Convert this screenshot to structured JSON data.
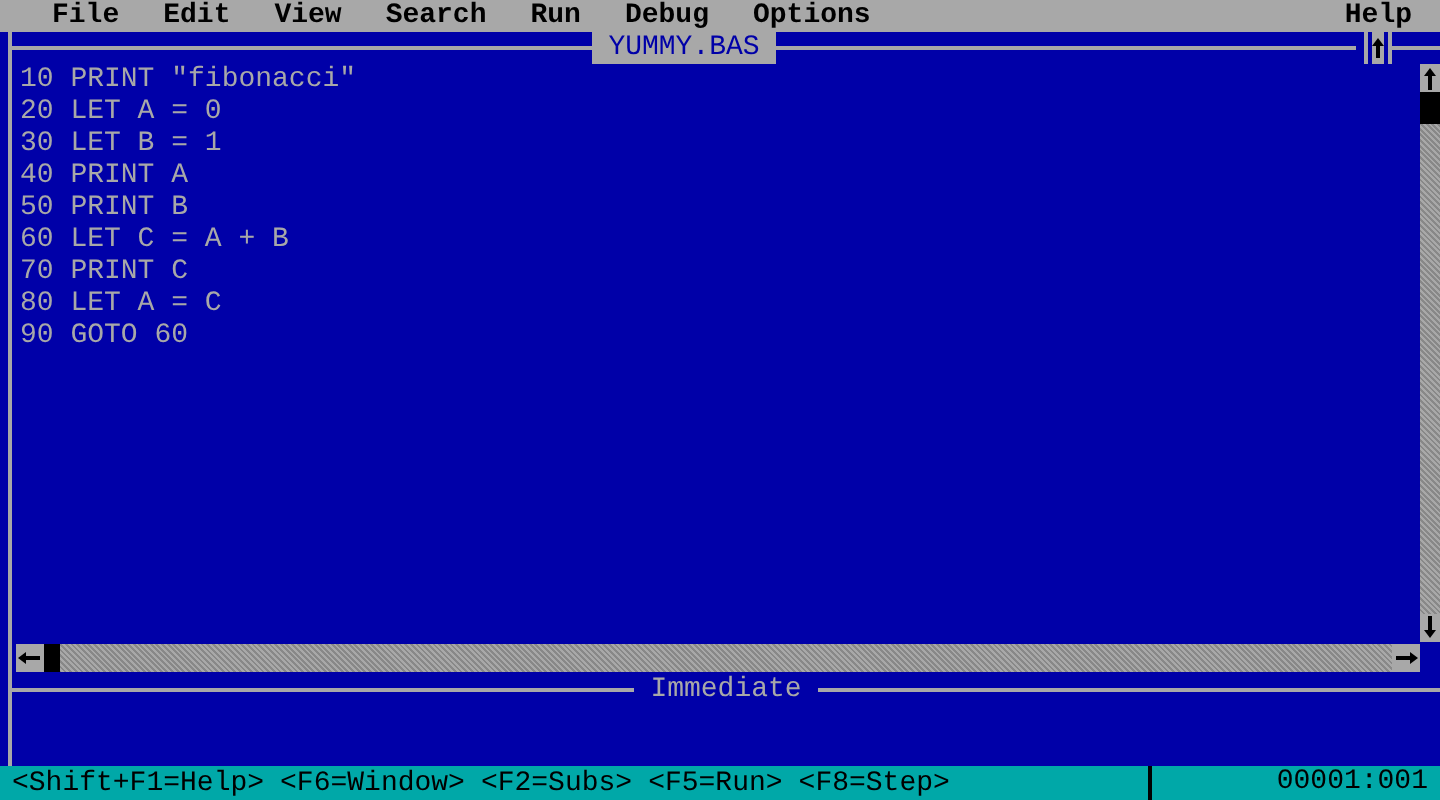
{
  "menu_bar": {
    "items": [
      "File",
      "Edit",
      "View",
      "Search",
      "Run",
      "Debug",
      "Options"
    ],
    "help": "Help"
  },
  "editor": {
    "title": "YUMMY.BAS",
    "lines": [
      "10 PRINT \"fibonacci\"",
      "20 LET A = 0",
      "30 LET B = 1",
      "40 PRINT A",
      "50 PRINT B",
      "60 LET C = A + B",
      "70 PRINT C",
      "80 LET A = C",
      "90 GOTO 60"
    ]
  },
  "immediate": {
    "title": "Immediate"
  },
  "status_bar": {
    "shortcuts": [
      "<Shift+F1=Help>",
      "<F6=Window>",
      "<F2=Subs>",
      "<F5=Run>",
      "<F8=Step>"
    ],
    "position": "00001:001"
  }
}
